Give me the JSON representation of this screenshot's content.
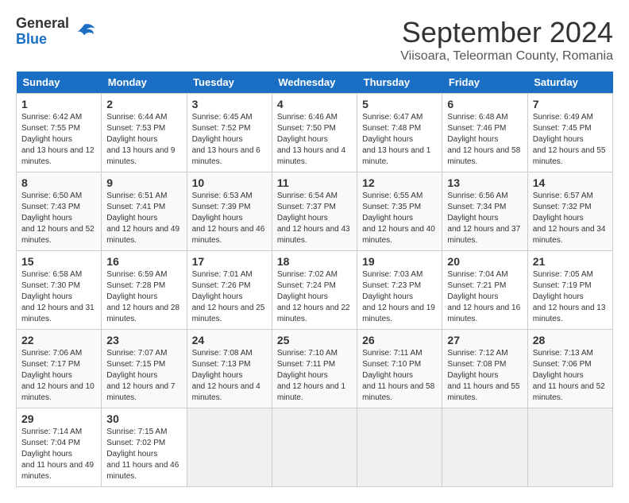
{
  "logo": {
    "general": "General",
    "blue": "Blue"
  },
  "title": "September 2024",
  "subtitle": "Viisoara, Teleorman County, Romania",
  "weekdays": [
    "Sunday",
    "Monday",
    "Tuesday",
    "Wednesday",
    "Thursday",
    "Friday",
    "Saturday"
  ],
  "weeks": [
    [
      {
        "day": "1",
        "sunrise": "6:42 AM",
        "sunset": "7:55 PM",
        "daylight": "13 hours and 12 minutes."
      },
      {
        "day": "2",
        "sunrise": "6:44 AM",
        "sunset": "7:53 PM",
        "daylight": "13 hours and 9 minutes."
      },
      {
        "day": "3",
        "sunrise": "6:45 AM",
        "sunset": "7:52 PM",
        "daylight": "13 hours and 6 minutes."
      },
      {
        "day": "4",
        "sunrise": "6:46 AM",
        "sunset": "7:50 PM",
        "daylight": "13 hours and 4 minutes."
      },
      {
        "day": "5",
        "sunrise": "6:47 AM",
        "sunset": "7:48 PM",
        "daylight": "13 hours and 1 minute."
      },
      {
        "day": "6",
        "sunrise": "6:48 AM",
        "sunset": "7:46 PM",
        "daylight": "12 hours and 58 minutes."
      },
      {
        "day": "7",
        "sunrise": "6:49 AM",
        "sunset": "7:45 PM",
        "daylight": "12 hours and 55 minutes."
      }
    ],
    [
      {
        "day": "8",
        "sunrise": "6:50 AM",
        "sunset": "7:43 PM",
        "daylight": "12 hours and 52 minutes."
      },
      {
        "day": "9",
        "sunrise": "6:51 AM",
        "sunset": "7:41 PM",
        "daylight": "12 hours and 49 minutes."
      },
      {
        "day": "10",
        "sunrise": "6:53 AM",
        "sunset": "7:39 PM",
        "daylight": "12 hours and 46 minutes."
      },
      {
        "day": "11",
        "sunrise": "6:54 AM",
        "sunset": "7:37 PM",
        "daylight": "12 hours and 43 minutes."
      },
      {
        "day": "12",
        "sunrise": "6:55 AM",
        "sunset": "7:35 PM",
        "daylight": "12 hours and 40 minutes."
      },
      {
        "day": "13",
        "sunrise": "6:56 AM",
        "sunset": "7:34 PM",
        "daylight": "12 hours and 37 minutes."
      },
      {
        "day": "14",
        "sunrise": "6:57 AM",
        "sunset": "7:32 PM",
        "daylight": "12 hours and 34 minutes."
      }
    ],
    [
      {
        "day": "15",
        "sunrise": "6:58 AM",
        "sunset": "7:30 PM",
        "daylight": "12 hours and 31 minutes."
      },
      {
        "day": "16",
        "sunrise": "6:59 AM",
        "sunset": "7:28 PM",
        "daylight": "12 hours and 28 minutes."
      },
      {
        "day": "17",
        "sunrise": "7:01 AM",
        "sunset": "7:26 PM",
        "daylight": "12 hours and 25 minutes."
      },
      {
        "day": "18",
        "sunrise": "7:02 AM",
        "sunset": "7:24 PM",
        "daylight": "12 hours and 22 minutes."
      },
      {
        "day": "19",
        "sunrise": "7:03 AM",
        "sunset": "7:23 PM",
        "daylight": "12 hours and 19 minutes."
      },
      {
        "day": "20",
        "sunrise": "7:04 AM",
        "sunset": "7:21 PM",
        "daylight": "12 hours and 16 minutes."
      },
      {
        "day": "21",
        "sunrise": "7:05 AM",
        "sunset": "7:19 PM",
        "daylight": "12 hours and 13 minutes."
      }
    ],
    [
      {
        "day": "22",
        "sunrise": "7:06 AM",
        "sunset": "7:17 PM",
        "daylight": "12 hours and 10 minutes."
      },
      {
        "day": "23",
        "sunrise": "7:07 AM",
        "sunset": "7:15 PM",
        "daylight": "12 hours and 7 minutes."
      },
      {
        "day": "24",
        "sunrise": "7:08 AM",
        "sunset": "7:13 PM",
        "daylight": "12 hours and 4 minutes."
      },
      {
        "day": "25",
        "sunrise": "7:10 AM",
        "sunset": "7:11 PM",
        "daylight": "12 hours and 1 minute."
      },
      {
        "day": "26",
        "sunrise": "7:11 AM",
        "sunset": "7:10 PM",
        "daylight": "11 hours and 58 minutes."
      },
      {
        "day": "27",
        "sunrise": "7:12 AM",
        "sunset": "7:08 PM",
        "daylight": "11 hours and 55 minutes."
      },
      {
        "day": "28",
        "sunrise": "7:13 AM",
        "sunset": "7:06 PM",
        "daylight": "11 hours and 52 minutes."
      }
    ],
    [
      {
        "day": "29",
        "sunrise": "7:14 AM",
        "sunset": "7:04 PM",
        "daylight": "11 hours and 49 minutes."
      },
      {
        "day": "30",
        "sunrise": "7:15 AM",
        "sunset": "7:02 PM",
        "daylight": "11 hours and 46 minutes."
      },
      null,
      null,
      null,
      null,
      null
    ]
  ]
}
